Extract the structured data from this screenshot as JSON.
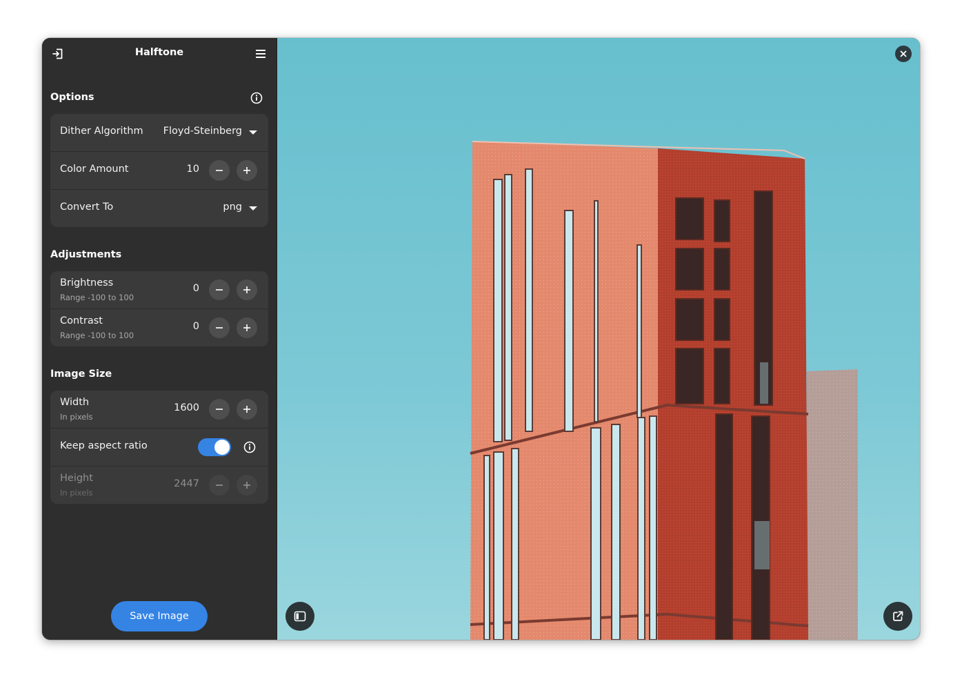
{
  "app": {
    "title": "Halftone"
  },
  "sections": {
    "options": "Options",
    "adjustments": "Adjustments",
    "image_size": "Image Size"
  },
  "options": {
    "dither_label": "Dither Algorithm",
    "dither_value": "Floyd-Steinberg",
    "color_amount_label": "Color Amount",
    "color_amount_value": "10",
    "convert_label": "Convert To",
    "convert_value": "png"
  },
  "adjustments": {
    "brightness_label": "Brightness",
    "brightness_sub": "Range -100 to 100",
    "brightness_value": "0",
    "contrast_label": "Contrast",
    "contrast_sub": "Range -100 to 100",
    "contrast_value": "0"
  },
  "image_size": {
    "width_label": "Width",
    "width_sub": "In pixels",
    "width_value": "1600",
    "aspect_label": "Keep aspect ratio",
    "aspect_on": true,
    "height_label": "Height",
    "height_sub": "In pixels",
    "height_value": "2447"
  },
  "save_label": "Save Image",
  "icons": {
    "open": "open-file-icon",
    "menu": "hamburger-menu-icon",
    "info": "info-icon",
    "close": "close-icon",
    "sidebar_toggle": "sidebar-toggle-icon",
    "open_external": "open-external-icon"
  },
  "colors": {
    "accent": "#3584e4",
    "sidebar_bg": "#2e2e2e",
    "card_bg": "#3a3a3a",
    "sky": "#6cc1cf",
    "building_light": "#e58a6d",
    "building_dark": "#bd4a35"
  }
}
